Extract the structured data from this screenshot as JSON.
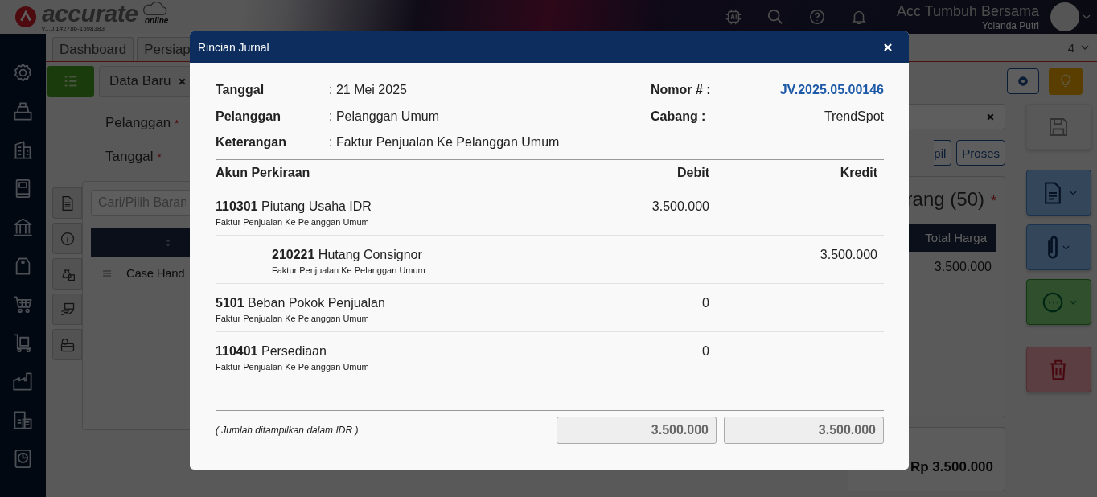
{
  "header": {
    "logo": "accurate",
    "logo_sub": "online",
    "version": "v1.0.1#2786-1598383",
    "company": "Acc Tumbuh Bersama",
    "user": "Yolanda Putri"
  },
  "tabs": [
    {
      "label": "Dashboard"
    },
    {
      "label": "Persiap"
    }
  ],
  "tab_count": "4",
  "doc_tab": {
    "label": "Data Baru"
  },
  "form_fields": [
    {
      "label": "Pelanggan",
      "mark": "*"
    },
    {
      "label": "Tanggal",
      "mark": "*"
    }
  ],
  "filter_buttons": [
    "pil",
    "Proses"
  ],
  "items_panel": {
    "search_placeholder": "Cari/Pilih Baran",
    "title": "rang (50)",
    "title_mark": "*",
    "column": "Total Harga",
    "rows": [
      {
        "name": "Case Hand",
        "total": "3.500.000"
      }
    ]
  },
  "summary": {
    "total": "Rp 3.500.000"
  },
  "modal": {
    "title": "Rincian Jurnal",
    "info_left": [
      {
        "label": "Tanggal",
        "value": ": 21 Mei 2025"
      },
      {
        "label": "Pelanggan",
        "value": ": Pelanggan Umum"
      },
      {
        "label": "Keterangan",
        "value": ": Faktur Penjualan Ke Pelanggan Umum"
      }
    ],
    "info_right": [
      {
        "label": "Nomor # :",
        "value": "JV.2025.05.00146",
        "kind": "link"
      },
      {
        "label": "Cabang :",
        "value": "TrendSpot",
        "kind": "text"
      }
    ],
    "columns": [
      "Akun Perkiraan",
      "Debit",
      "Kredit"
    ],
    "entries": [
      {
        "account": "**110301** Piutang Usaha IDR",
        "note": "Faktur Penjualan Ke Pelanggan Umum",
        "amount": "3.500.000",
        "kind": "debit"
      },
      {
        "account": "**210221** Hutang Consignor",
        "note": "Faktur Penjualan Ke Pelanggan Umum",
        "amount": "3.500.000",
        "kind": "credit"
      },
      {
        "account": "**5101** Beban Pokok Penjualan",
        "note": "Faktur Penjualan Ke Pelanggan Umum",
        "amount": "0",
        "kind": "debit"
      },
      {
        "account": "**110401** Persediaan",
        "note": "Faktur Penjualan Ke Pelanggan Umum",
        "amount": "0",
        "kind": "debit"
      }
    ],
    "currency_note": "( Jumlah ditampilkan dalam IDR )",
    "total_debit": "3.500.000",
    "total_credit": "3.500.000"
  }
}
